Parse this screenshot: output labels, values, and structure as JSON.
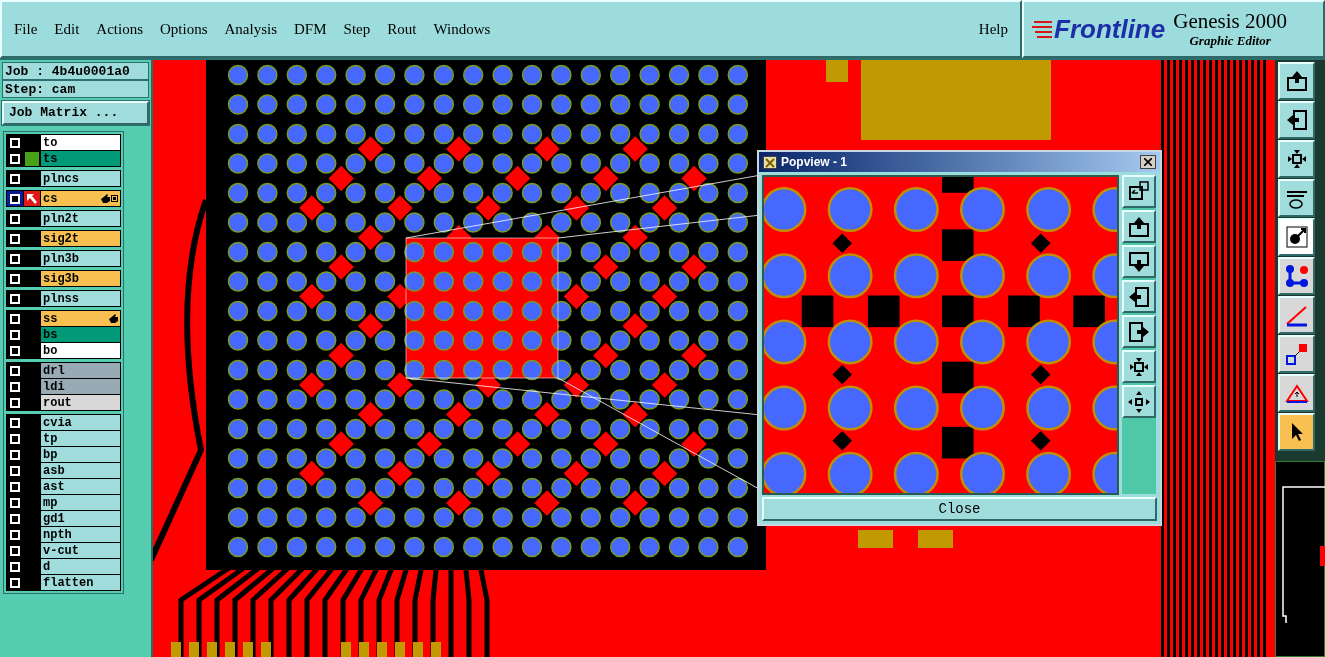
{
  "menu": [
    "File",
    "Edit",
    "Actions",
    "Options",
    "Analysis",
    "DFM",
    "Step",
    "Rout",
    "Windows"
  ],
  "help": "Help",
  "logo": {
    "brand": "Frontline",
    "product": "Genesis 2000",
    "subtitle": "Graphic Editor"
  },
  "job": {
    "job": "Job : 4b4u0001a0",
    "step": "Step: cam",
    "matrix_button": "Job Matrix ..."
  },
  "layer_groups": [
    [
      {
        "name": "to",
        "color": "#ffffff",
        "work": false,
        "hand": false,
        "swatch": false
      },
      {
        "name": "ts",
        "color": "#009a78",
        "work": false,
        "hand": false,
        "swatch": true
      }
    ],
    [
      {
        "name": "plncs",
        "color": "#a0dcdc",
        "work": false,
        "hand": false,
        "swatch": false
      }
    ],
    [
      {
        "name": "cs",
        "color": "#f8c050",
        "work": true,
        "hand": true,
        "swatch": false
      }
    ],
    [
      {
        "name": "pln2t",
        "color": "#a0dcdc",
        "work": false,
        "hand": false,
        "swatch": false
      }
    ],
    [
      {
        "name": "sig2t",
        "color": "#f8c050",
        "work": false,
        "hand": false,
        "swatch": false
      }
    ],
    [
      {
        "name": "pln3b",
        "color": "#a0dcdc",
        "work": false,
        "hand": false,
        "swatch": false
      }
    ],
    [
      {
        "name": "sig3b",
        "color": "#f8c050",
        "work": false,
        "hand": false,
        "swatch": false
      }
    ],
    [
      {
        "name": "plnss",
        "color": "#a0dcdc",
        "work": false,
        "hand": false,
        "swatch": false
      }
    ],
    [
      {
        "name": "ss",
        "color": "#f8c050",
        "work": false,
        "hand": true,
        "swatch": false
      },
      {
        "name": "bs",
        "color": "#009a78",
        "work": false,
        "hand": false,
        "swatch": false
      },
      {
        "name": "bo",
        "color": "#ffffff",
        "work": false,
        "hand": false,
        "swatch": false
      }
    ],
    [
      {
        "name": "drl",
        "color": "#98aab4",
        "work": false,
        "hand": false,
        "swatch": false
      },
      {
        "name": "ldi",
        "color": "#98aab4",
        "work": false,
        "hand": false,
        "swatch": false
      },
      {
        "name": "rout",
        "color": "#d8d8d8",
        "work": false,
        "hand": false,
        "swatch": false
      }
    ],
    [
      {
        "name": "cvia",
        "color": "#a0dcdc",
        "work": false,
        "hand": false,
        "swatch": false
      },
      {
        "name": "tp",
        "color": "#a0dcdc",
        "work": false,
        "hand": false,
        "swatch": false
      },
      {
        "name": "bp",
        "color": "#a0dcdc",
        "work": false,
        "hand": false,
        "swatch": false
      },
      {
        "name": "asb",
        "color": "#a0dcdc",
        "work": false,
        "hand": false,
        "swatch": false
      },
      {
        "name": "ast",
        "color": "#a0dcdc",
        "work": false,
        "hand": false,
        "swatch": false
      },
      {
        "name": "mp",
        "color": "#a0dcdc",
        "work": false,
        "hand": false,
        "swatch": false
      },
      {
        "name": "gd1",
        "color": "#a0dcdc",
        "work": false,
        "hand": false,
        "swatch": false
      },
      {
        "name": "npth",
        "color": "#a0dcdc",
        "work": false,
        "hand": false,
        "swatch": false
      },
      {
        "name": "v-cut",
        "color": "#a0dcdc",
        "work": false,
        "hand": false,
        "swatch": false
      },
      {
        "name": "d",
        "color": "#a0dcdc",
        "work": false,
        "hand": false,
        "swatch": false
      },
      {
        "name": "flatten",
        "color": "#a0dcdc",
        "work": false,
        "hand": false,
        "swatch": false
      }
    ]
  ],
  "popview": {
    "title": "Popview - 1",
    "close_button": "Close"
  }
}
